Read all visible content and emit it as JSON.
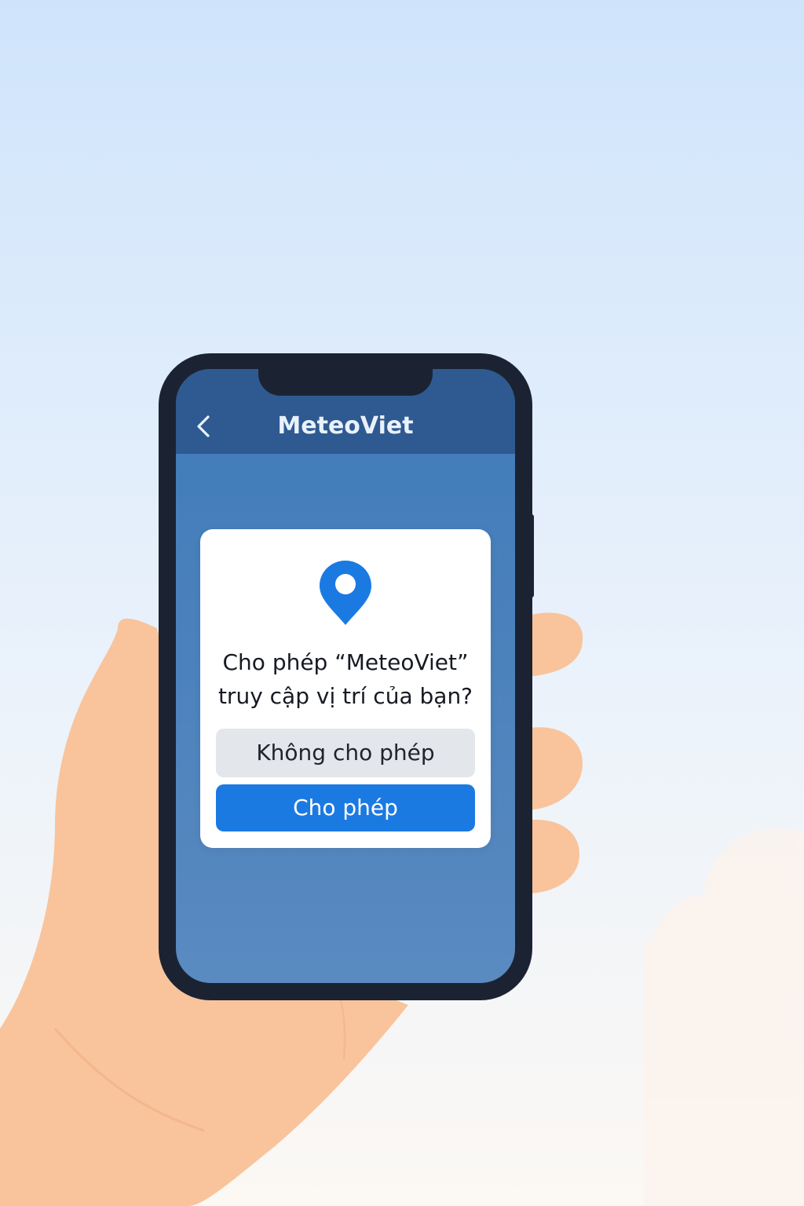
{
  "app": {
    "title": "MeteoViet",
    "back_icon": "chevron-left-icon"
  },
  "permission_dialog": {
    "icon": "location-pin-icon",
    "message_line1": "Cho phép “MeteoViet”",
    "message_line2": "truy cập vị trí của bạn?",
    "deny_label": "Không cho phép",
    "allow_label": "Cho phép"
  },
  "colors": {
    "header": "#2e5a91",
    "screen": "#3f7bb9",
    "accent": "#1b7ae2",
    "deny_button": "#e3e6ea",
    "phone_frame": "#1b2333",
    "skin": "#f9c49c"
  }
}
